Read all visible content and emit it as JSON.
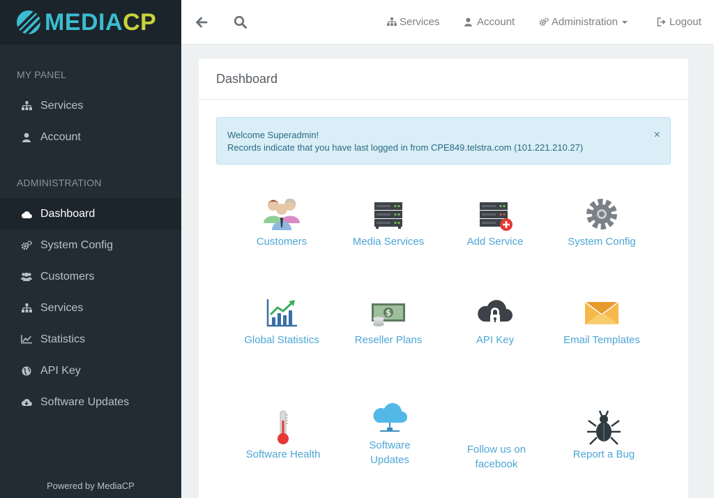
{
  "brand": {
    "part1": "MEDIA",
    "part2": "CP"
  },
  "sidebar": {
    "section1_title": "MY PANEL",
    "section1_items": [
      {
        "label": "Services",
        "icon": "sitemap-icon"
      },
      {
        "label": "Account",
        "icon": "user-icon"
      }
    ],
    "section2_title": "ADMINISTRATION",
    "section2_items": [
      {
        "label": "Dashboard",
        "icon": "cloud-icon",
        "active": true
      },
      {
        "label": "System Config",
        "icon": "cogs-icon"
      },
      {
        "label": "Customers",
        "icon": "users-icon"
      },
      {
        "label": "Services",
        "icon": "sitemap-icon"
      },
      {
        "label": "Statistics",
        "icon": "line-chart-icon"
      },
      {
        "label": "API Key",
        "icon": "globe-icon"
      },
      {
        "label": "Software Updates",
        "icon": "cloud-download-icon"
      }
    ],
    "powered_by": "Powered by MediaCP"
  },
  "topbar": {
    "services": "Services",
    "account": "Account",
    "administration": "Administration",
    "logout": "Logout"
  },
  "panel": {
    "title": "Dashboard",
    "alert_line1": "Welcome Superadmin!",
    "alert_line2": "Records indicate that you have last logged in from CPE849.telstra.com (101.221.210.27)",
    "alert_close": "×"
  },
  "tiles": [
    {
      "line1": "Customers",
      "line2": "",
      "icon": "customers-icon"
    },
    {
      "line1": "Media Services",
      "line2": "",
      "icon": "server-icon"
    },
    {
      "line1": "Add Service",
      "line2": "",
      "icon": "add-server-icon"
    },
    {
      "line1": "System Config",
      "line2": "",
      "icon": "gear-icon"
    },
    {
      "line1": "Global Statistics",
      "line2": "",
      "icon": "bar-chart-icon"
    },
    {
      "line1": "Reseller Plans",
      "line2": "",
      "icon": "money-icon"
    },
    {
      "line1": "API Key",
      "line2": "",
      "icon": "cloud-lock-icon"
    },
    {
      "line1": "Email Templates",
      "line2": "",
      "icon": "envelope-icon"
    },
    {
      "line1": "Software Health",
      "line2": "",
      "icon": "thermometer-icon"
    },
    {
      "line1": "Software",
      "line2": "Updates",
      "icon": "cloud-network-icon"
    },
    {
      "line1": "Follow us on",
      "line2": "facebook",
      "icon": "facebook-icon"
    },
    {
      "line1": "Report a Bug",
      "line2": "",
      "icon": "bug-icon"
    }
  ],
  "colors": {
    "accent": "#4da6d6",
    "sidebar": "#222c34",
    "brand_blue": "#3cbcd0",
    "brand_green": "#c9d43a"
  }
}
